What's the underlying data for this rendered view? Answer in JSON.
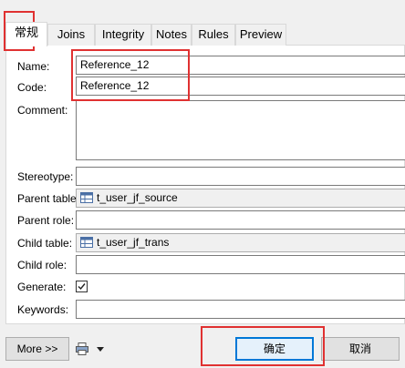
{
  "tabs": [
    {
      "label": "常规",
      "active": true
    },
    {
      "label": "Joins"
    },
    {
      "label": "Integrity"
    },
    {
      "label": "Notes"
    },
    {
      "label": "Rules"
    },
    {
      "label": "Preview"
    }
  ],
  "form": {
    "name_label": "Name:",
    "name_value": "Reference_12",
    "code_label": "Code:",
    "code_value": "Reference_12",
    "comment_label": "Comment:",
    "comment_value": "",
    "stereotype_label": "Stereotype:",
    "stereotype_value": "",
    "parent_table_label": "Parent table:",
    "parent_table_value": "t_user_jf_source",
    "parent_role_label": "Parent role:",
    "parent_role_value": "",
    "child_table_label": "Child table:",
    "child_table_value": "t_user_jf_trans",
    "child_role_label": "Child role:",
    "child_role_value": "",
    "generate_label": "Generate:",
    "generate_checked": true,
    "keywords_label": "Keywords:",
    "keywords_value": ""
  },
  "footer": {
    "more_label": "More >>",
    "ok_label": "确定",
    "cancel_label": "取消"
  },
  "colors": {
    "highlight": "#e03131",
    "default_button": "#0078d7"
  },
  "icons": {
    "table": "table-icon",
    "print": "print-icon",
    "dropdown": "dropdown-arrow-icon",
    "check": "checkmark-icon"
  }
}
